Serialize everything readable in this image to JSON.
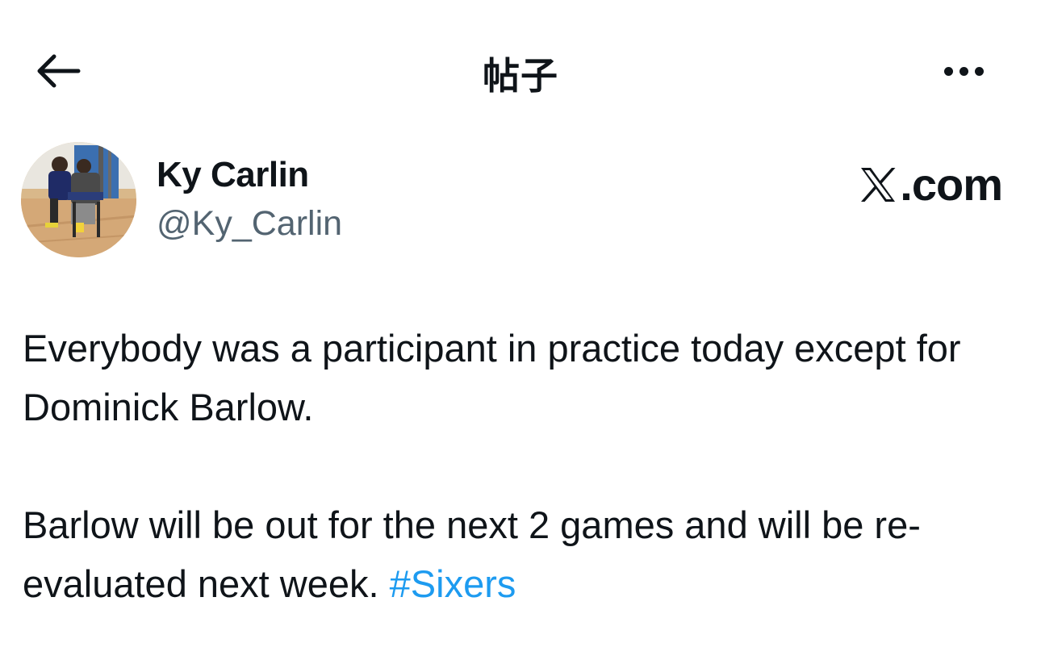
{
  "header": {
    "title": "帖子",
    "back_icon": "arrow-left-icon",
    "more_icon": "more-horizontal-icon"
  },
  "author": {
    "display_name": "Ky Carlin",
    "handle": "@Ky_Carlin",
    "avatar": "avatar-photo"
  },
  "brand": {
    "icon": "x-logo-icon",
    "text": ".com"
  },
  "tweet": {
    "paragraph1": "Everybody was a participant in practice today except for Dominick Barlow.",
    "paragraph2_text": "Barlow will be out for the next 2 games and will be re-evaluated next week.",
    "hashtag": "#Sixers"
  },
  "colors": {
    "text_primary": "#0f1419",
    "text_secondary": "#536471",
    "link": "#1d9bf0",
    "background": "#ffffff"
  }
}
